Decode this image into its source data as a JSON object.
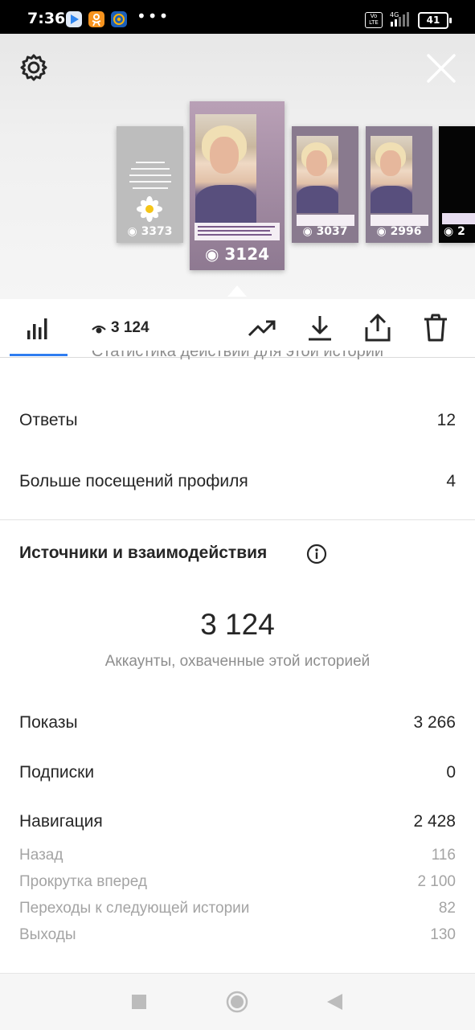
{
  "status_bar": {
    "time": "7:36",
    "volte_label": "Vo LTE",
    "network": "4G",
    "battery": "41"
  },
  "stories": [
    {
      "views": "3373"
    },
    {
      "views": "3124"
    },
    {
      "views": "3037"
    },
    {
      "views": "2996"
    },
    {
      "views": "2"
    }
  ],
  "toolbar": {
    "views": "3 124"
  },
  "actions": {
    "partial_heading": "Статистика действий для этой истории",
    "rows": [
      {
        "label": "Ответы",
        "value": "12"
      },
      {
        "label": "Больше посещений профиля",
        "value": "4"
      }
    ]
  },
  "sources": {
    "title": "Источники и взаимодействия",
    "reach_value": "3 124",
    "reach_caption": "Аккаунты, охваченные этой историей",
    "rows": [
      {
        "label": "Показы",
        "value": "3 266"
      },
      {
        "label": "Подписки",
        "value": "0"
      },
      {
        "label": "Навигация",
        "value": "2 428"
      }
    ],
    "navigation_details": [
      {
        "label": "Назад",
        "value": "116"
      },
      {
        "label": "Прокрутка вперед",
        "value": "2 100"
      },
      {
        "label": "Переходы к следующей истории",
        "value": "82"
      },
      {
        "label": "Выходы",
        "value": "130"
      }
    ]
  },
  "colors": {
    "accent_underline": "#2f7df0",
    "text_primary": "#262626",
    "text_secondary": "#8e8e8e"
  },
  "icons": {
    "settings": "gear-icon",
    "close": "close-icon",
    "stats": "bar-chart-icon",
    "views": "eye-icon",
    "promote": "trending-up-icon",
    "download": "download-icon",
    "share": "share-icon",
    "delete": "trash-icon",
    "info": "info-icon"
  }
}
